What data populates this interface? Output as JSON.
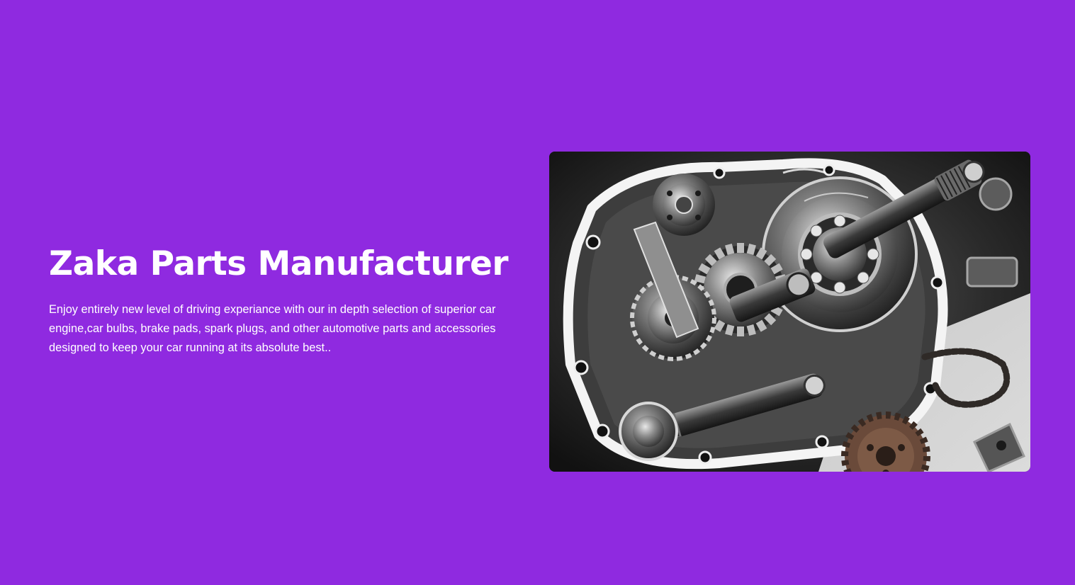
{
  "page": {
    "background_color": "#8f2ae0"
  },
  "hero": {
    "title": "Zaka Parts Manufacturer",
    "description": "Enjoy entirely new level of driving experiance with our in depth selection of superior car engine,car bulbs, brake pads, spark plugs, and other automotive parts and accessories designed to keep your car running at its absolute best..",
    "image": {
      "icon": "engine-gearbox-photo"
    }
  }
}
